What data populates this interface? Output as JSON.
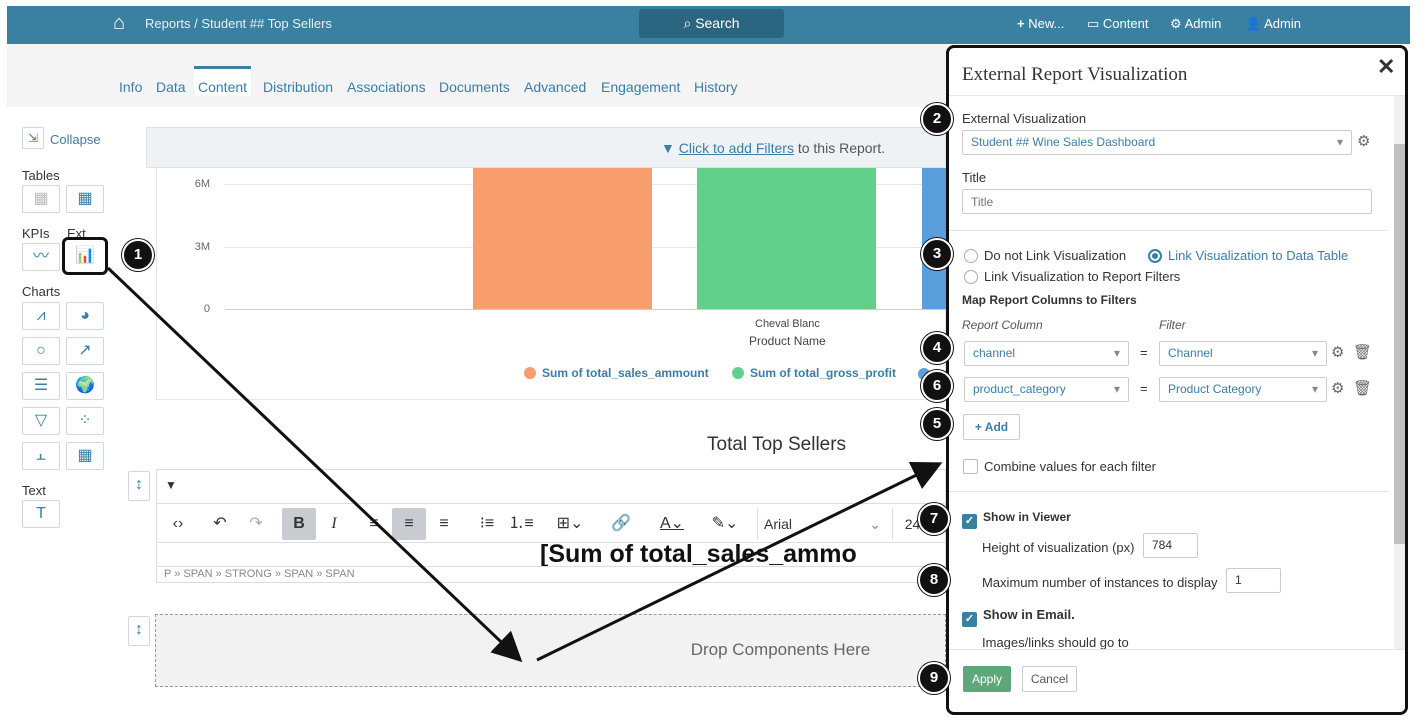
{
  "topbar": {
    "breadcrumb": "Reports / Student ## Top Sellers",
    "search": "Search",
    "new": "New...",
    "content": "Content",
    "admin_menu": "Admin",
    "user": "Admin"
  },
  "tabs": [
    "Info",
    "Data",
    "Content",
    "Distribution",
    "Associations",
    "Documents",
    "Advanced",
    "Engagement",
    "History"
  ],
  "sidebar": {
    "collapse": "Collapse",
    "tables": "Tables",
    "kpis": "KPIs",
    "ext": "Ext",
    "charts": "Charts",
    "text": "Text"
  },
  "filterbar": {
    "link": "Click to add Filters",
    "suffix": " to this Report."
  },
  "chart_data": {
    "type": "bar",
    "categories": [
      "Cheval Blanc"
    ],
    "xlabel": "Product Name",
    "yticks": [
      "0",
      "3M",
      "6M"
    ],
    "series": [
      {
        "name": "Sum of total_sales_ammount",
        "color": "#f79d6e"
      },
      {
        "name": "Sum of total_gross_profit",
        "color": "#62d08a"
      },
      {
        "name": "",
        "color": "#5a9fdc"
      }
    ]
  },
  "section_title": "Total Top Sellers",
  "editor": {
    "font": "Arial",
    "size": "24",
    "content": "[Sum of total_sales_ammo",
    "path": "P » SPAN » STRONG » SPAN » SPAN"
  },
  "dropzone": "Drop Components Here",
  "panel": {
    "title": "External Report Visualization",
    "ext_vis_label": "External Visualization",
    "ext_vis_value": "Student ## Wine Sales Dashboard",
    "title_label": "Title",
    "title_placeholder": "Title",
    "radio_nolink": "Do not Link Visualization",
    "radio_table": "Link Visualization to Data Table",
    "radio_filters": "Link Visualization to Report Filters",
    "map_heading": "Map Report Columns to Filters",
    "col_report": "Report Column",
    "col_filter": "Filter",
    "mappings": [
      {
        "column": "channel",
        "filter": "Channel"
      },
      {
        "column": "product_category",
        "filter": "Product Category"
      }
    ],
    "add": "Add",
    "combine": "Combine values for each filter",
    "show_viewer": "Show in Viewer",
    "height_label": "Height of visualization (px)",
    "height_value": "784",
    "max_label": "Maximum number of instances to display",
    "max_value": "1",
    "show_email": "Show in Email.",
    "images_links": "Images/links should go to",
    "apply": "Apply",
    "cancel": "Cancel"
  },
  "badges": [
    "1",
    "2",
    "3",
    "4",
    "5",
    "6",
    "7",
    "8",
    "9"
  ]
}
